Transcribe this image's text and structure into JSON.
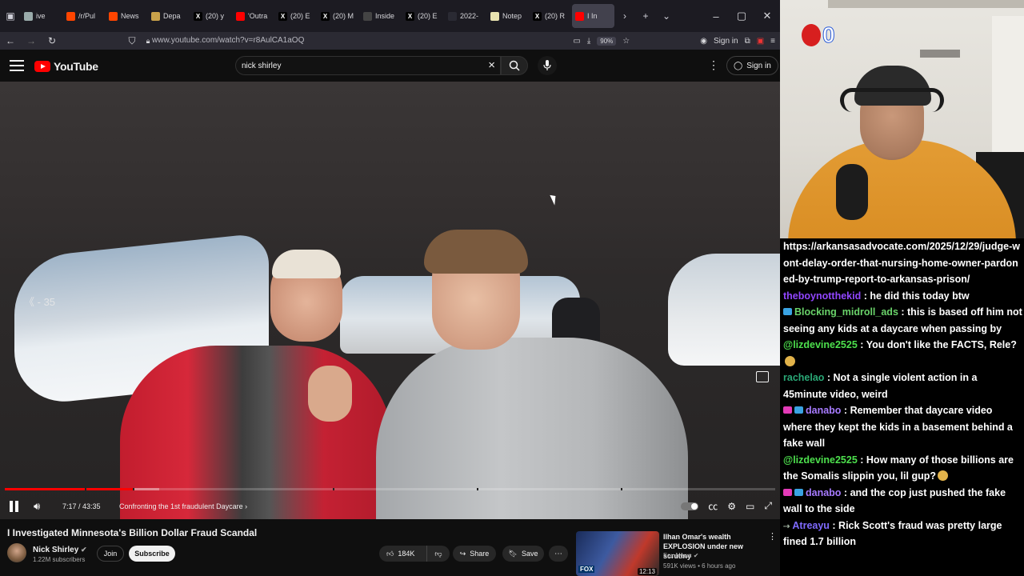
{
  "browser": {
    "tabs": [
      {
        "label": "ive",
        "icon": "chevron-left-icon",
        "color": "#9aa"
      },
      {
        "label": "/r/Pul",
        "icon": "reddit-icon",
        "color": "#ff4500"
      },
      {
        "label": "News",
        "icon": "reddit-icon",
        "color": "#ff4500"
      },
      {
        "label": "Depa",
        "icon": "globe-icon",
        "color": "#c9a24a"
      },
      {
        "label": "(20) y",
        "icon": "x-icon",
        "color": "#000000"
      },
      {
        "label": "'Outra",
        "icon": "youtube-icon",
        "color": "#ff0000"
      },
      {
        "label": "(20) E",
        "icon": "x-icon",
        "color": "#000000"
      },
      {
        "label": "(20) M",
        "icon": "x-icon",
        "color": "#000000"
      },
      {
        "label": "Inside",
        "icon": "globe-icon",
        "color": "#444444"
      },
      {
        "label": "(20) E",
        "icon": "x-icon",
        "color": "#000000"
      },
      {
        "label": "2022-",
        "icon": "doc-icon",
        "color": "#2a2a33"
      },
      {
        "label": "Notep",
        "icon": "notepad-icon",
        "color": "#e8e3b0"
      },
      {
        "label": "(20) R",
        "icon": "x-icon",
        "color": "#000000"
      },
      {
        "label": "I In",
        "icon": "youtube-icon",
        "color": "#ff0000",
        "active": true
      }
    ],
    "url": "www.youtube.com/watch?v=r8AulCA1aOQ",
    "zoom": "90%",
    "signin_label": "Sign in"
  },
  "youtube": {
    "logo_text": "YouTube",
    "search_value": "nick shirley",
    "signin_label": "Sign in"
  },
  "player": {
    "skip_label": "- 35",
    "time": "7:17 / 43:35",
    "chapter": "Confronting the 1st fraudulent Daycare",
    "progress_played": 0.167,
    "progress_buffered": 0.2
  },
  "video": {
    "title": "I Investigated Minnesota's Billion Dollar Fraud Scandal",
    "channel": "Nick Shirley",
    "subscribers": "1.22M subscribers",
    "join_label": "Join",
    "subscribe_label": "Subscribe",
    "likes": "184K",
    "share_label": "Share",
    "save_label": "Save"
  },
  "recommended": {
    "title": "Ilhan Omar's wealth EXPLOSION under new scrutiny",
    "channel": "Fox News",
    "meta": "591K views • 6 hours ago",
    "duration": "12:13",
    "brand": "FOX"
  },
  "webcam": {
    "score": "0"
  },
  "chat": [
    {
      "user": "",
      "color": "#ffffff",
      "text": "https://arkansasadvocate.com/2025/12/29/judge-wont-delay-order-that-nursing-home-owner-pardoned-by-trump-report-to-arkansas-prison/",
      "badges": []
    },
    {
      "user": "theboynotthekid",
      "color": "#9146ff",
      "text": "he did this today btw",
      "badges": []
    },
    {
      "user": "Blocking_midroll_ads",
      "color": "#6ad36a",
      "text": "this is based off him not seeing any kids at a daycare when passing by",
      "badges": [
        "sub"
      ]
    },
    {
      "user": "@lizdevine2525",
      "color": "#4de04d",
      "text": "You don't like the FACTS, Rele?",
      "badges": [],
      "emote": true
    },
    {
      "user": "rachelao",
      "color": "#2aa876",
      "text": "Not a single violent action in a 45minute video, weird",
      "badges": []
    },
    {
      "user": "danabo",
      "color": "#a77bff",
      "text": "Remember that daycare video where they kept the kids in a basement behind a fake wall",
      "badges": [
        "heart",
        "sub"
      ]
    },
    {
      "user": "@lizdevine2525",
      "color": "#4de04d",
      "text": "How many of those billions are the Somalis slippin you, lil gup?",
      "badges": [],
      "emote": true
    },
    {
      "user": "danabo",
      "color": "#a77bff",
      "text": "and the cop just pushed the fake wall to the side",
      "badges": [
        "heart",
        "sub"
      ]
    },
    {
      "user": "Atreayu",
      "color": "#7f6bff",
      "text": "Rick Scott's fraud was pretty large fined 1.7 billion",
      "badges": [
        "arrow"
      ]
    }
  ]
}
